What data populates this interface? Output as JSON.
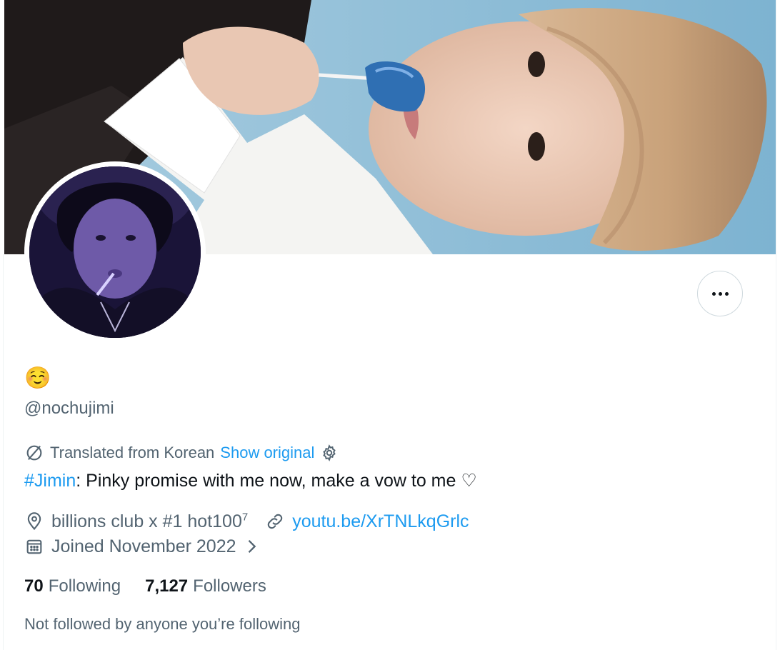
{
  "profile": {
    "display_name": "☺️",
    "handle": "@nochujimi",
    "translation": {
      "note": "Translated from Korean",
      "show_original": "Show original"
    },
    "bio": {
      "hashtag": "#Jimin",
      "text": ": Pinky promise with me now, make a vow to me ♡"
    },
    "location": "billions club x #1 hot100",
    "location_superscript": "7",
    "website": "youtu.be/XrTNLkqGrlc",
    "joined": "Joined November 2022",
    "following_count": "70",
    "following_label": "Following",
    "followers_count": "7,127",
    "followers_label": "Followers",
    "mutuals_note": "Not followed by anyone you’re following"
  },
  "icons": {
    "more": "more-horizontal-icon",
    "translate": "translate-icon",
    "settings": "gear-icon",
    "location": "location-pin-icon",
    "link": "link-icon",
    "calendar": "calendar-icon",
    "chevron": "chevron-right-icon"
  },
  "colors": {
    "accent": "#1d9bf0",
    "secondary_text": "#536471",
    "primary_text": "#0f1419"
  }
}
